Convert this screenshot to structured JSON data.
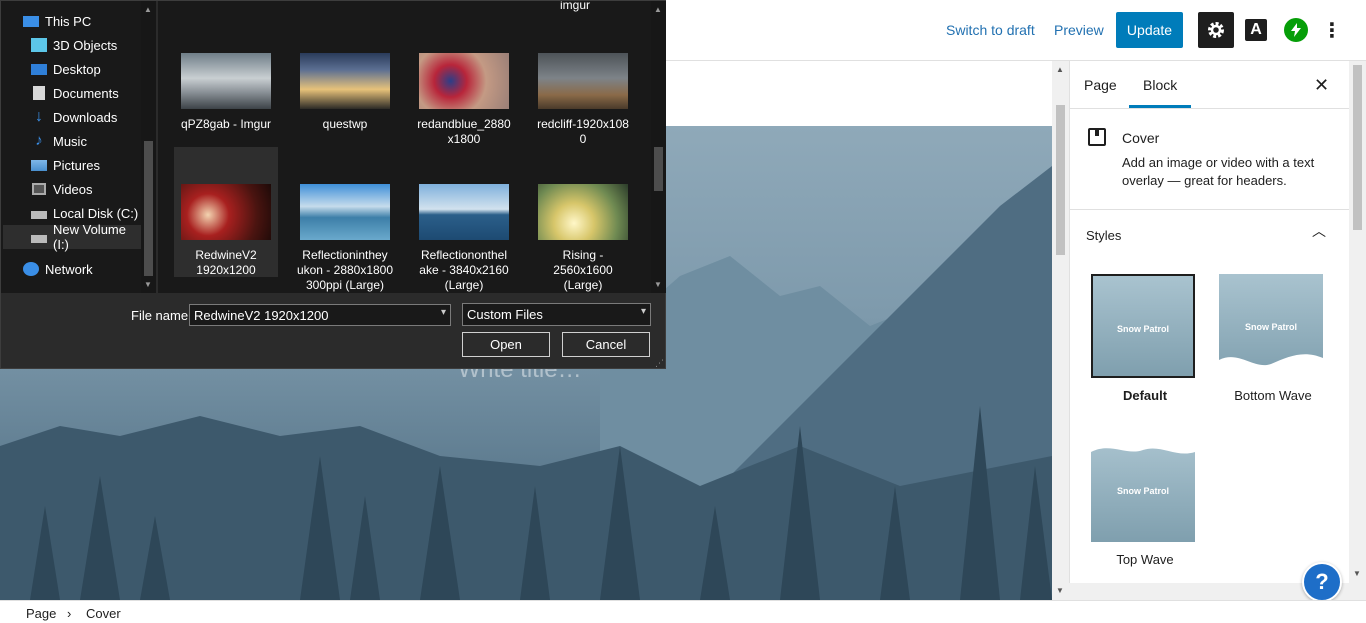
{
  "toolbar": {
    "switch_to_draft": "Switch to draft",
    "preview": "Preview",
    "update": "Update",
    "settings_icon": "gear-icon",
    "a_label": "A",
    "more": "⋮"
  },
  "cover": {
    "title_placeholder": "Write title…"
  },
  "sidebar": {
    "tabs": [
      "Page",
      "Block"
    ],
    "active_tab": "Block",
    "close": "✕",
    "block_name": "Cover",
    "block_desc": "Add an image or video with a text overlay — great for headers.",
    "styles_heading": "Styles",
    "styles": [
      {
        "label": "Default",
        "thumb_text": "Snow Patrol"
      },
      {
        "label": "Bottom Wave",
        "thumb_text": "Snow Patrol"
      },
      {
        "label": "Top Wave",
        "thumb_text": "Snow Patrol"
      }
    ]
  },
  "help": "?",
  "breadcrumb": {
    "items": [
      "Page",
      "Cover"
    ],
    "separator": "›"
  },
  "dialog": {
    "nav": [
      "This PC",
      "3D Objects",
      "Desktop",
      "Documents",
      "Downloads",
      "Music",
      "Pictures",
      "Videos",
      "Local Disk (C:)",
      "New Volume (I:)",
      "Network"
    ],
    "top_partial": "imgur",
    "files": [
      {
        "name": "qPZ8gab - Imgur"
      },
      {
        "name": "questwp"
      },
      {
        "name": "redandblue_2880\nx1800"
      },
      {
        "name": "redcliff-1920x108\n0"
      },
      {
        "name": "RedwineV2\n1920x1200"
      },
      {
        "name": "Reflectioninthey\nukon - 2880x1800\n300ppi (Large)"
      },
      {
        "name": "Reflectiononthel\nake - 3840x2160\n(Large)"
      },
      {
        "name": "Rising -\n2560x1600\n(Large)"
      }
    ],
    "file_name_label": "File name:",
    "file_name_value": "RedwineV2 1920x1200",
    "file_type": "Custom Files",
    "open": "Open",
    "cancel": "Cancel"
  }
}
